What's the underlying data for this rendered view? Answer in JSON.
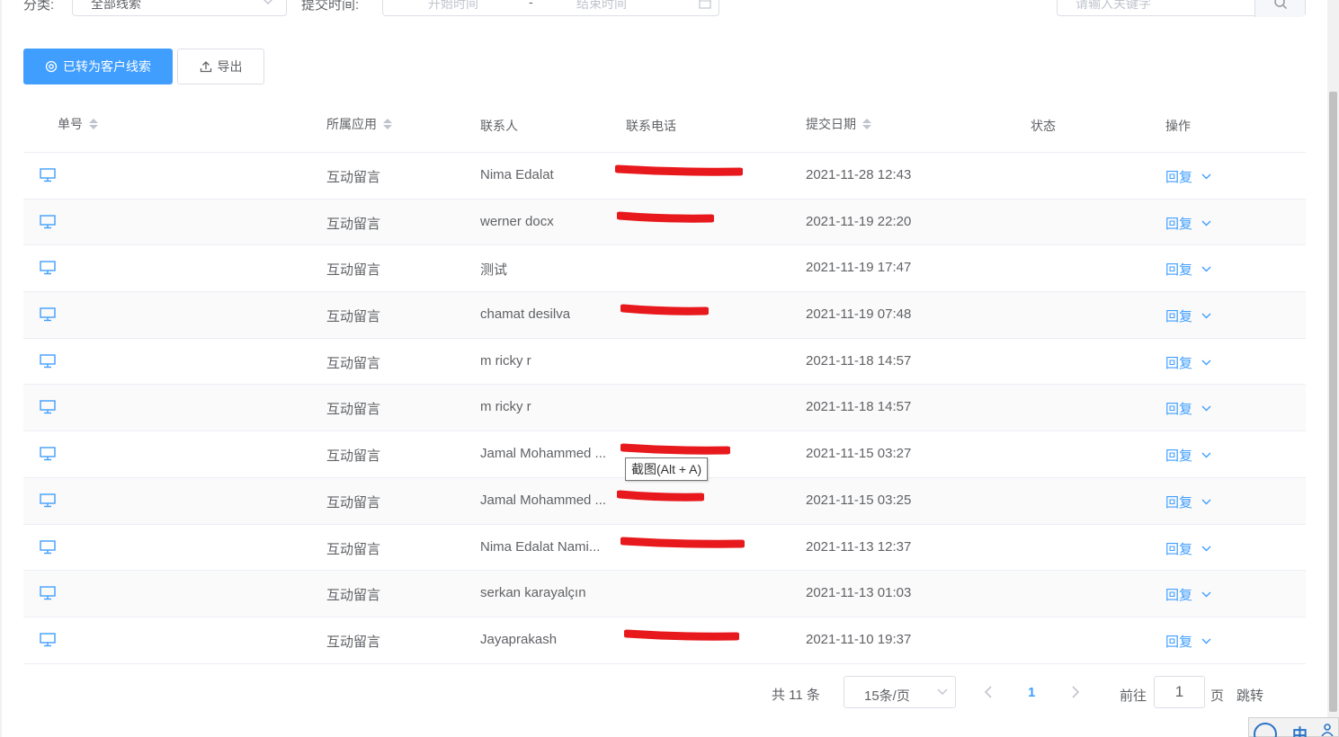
{
  "filters": {
    "category_label": "分类:",
    "category_value": "全部线索",
    "time_label": "提交时间:",
    "start_placeholder": "开始时间",
    "range_separator": "-",
    "end_placeholder": "结束时间",
    "keyword_placeholder": "请输入关键字"
  },
  "toolbar": {
    "converted_label": "已转为客户线索",
    "export_label": "导出"
  },
  "table": {
    "columns": {
      "id": "单号",
      "app": "所属应用",
      "contact": "联系人",
      "phone": "联系电话",
      "date": "提交日期",
      "status": "状态",
      "action": "操作"
    },
    "rows": [
      {
        "app": "互动留言",
        "contact": "Nima Edalat",
        "date": "2021-11-28 12:43",
        "action": "回复",
        "phone_redacted": true
      },
      {
        "app": "互动留言",
        "contact": "werner docx",
        "date": "2021-11-19 22:20",
        "action": "回复",
        "phone_redacted": true
      },
      {
        "app": "互动留言",
        "contact": "测试",
        "date": "2021-11-19 17:47",
        "action": "回复",
        "phone_redacted": false
      },
      {
        "app": "互动留言",
        "contact": "chamat desilva",
        "date": "2021-11-19 07:48",
        "action": "回复",
        "phone_redacted": true
      },
      {
        "app": "互动留言",
        "contact": "m ricky r",
        "date": "2021-11-18 14:57",
        "action": "回复",
        "phone_redacted": false
      },
      {
        "app": "互动留言",
        "contact": "m ricky r",
        "date": "2021-11-18 14:57",
        "action": "回复",
        "phone_redacted": false
      },
      {
        "app": "互动留言",
        "contact": "Jamal Mohammed ...",
        "date": "2021-11-15 03:27",
        "action": "回复",
        "phone_redacted": true
      },
      {
        "app": "互动留言",
        "contact": "Jamal Mohammed ...",
        "date": "2021-11-15 03:25",
        "action": "回复",
        "phone_redacted": true
      },
      {
        "app": "互动留言",
        "contact": "Nima Edalat Nami...",
        "date": "2021-11-13 12:37",
        "action": "回复",
        "phone_redacted": true
      },
      {
        "app": "互动留言",
        "contact": "serkan karayalçın",
        "date": "2021-11-13 01:03",
        "action": "回复",
        "phone_redacted": false
      },
      {
        "app": "互动留言",
        "contact": "Jayaprakash",
        "date": "2021-11-10 19:37",
        "action": "回复",
        "phone_redacted": true
      }
    ]
  },
  "tooltip": "截图(Alt + A)",
  "pagination": {
    "total": "共 11 条",
    "page_size": "15条/页",
    "current_page": "1",
    "goto_label": "前往",
    "goto_value": "1",
    "page_suffix": "页",
    "jump_label": "跳转"
  },
  "ime": {
    "mode": "中"
  },
  "colors": {
    "primary": "#409eff",
    "redaction": "#e8191d",
    "border": "#ebeef5"
  }
}
